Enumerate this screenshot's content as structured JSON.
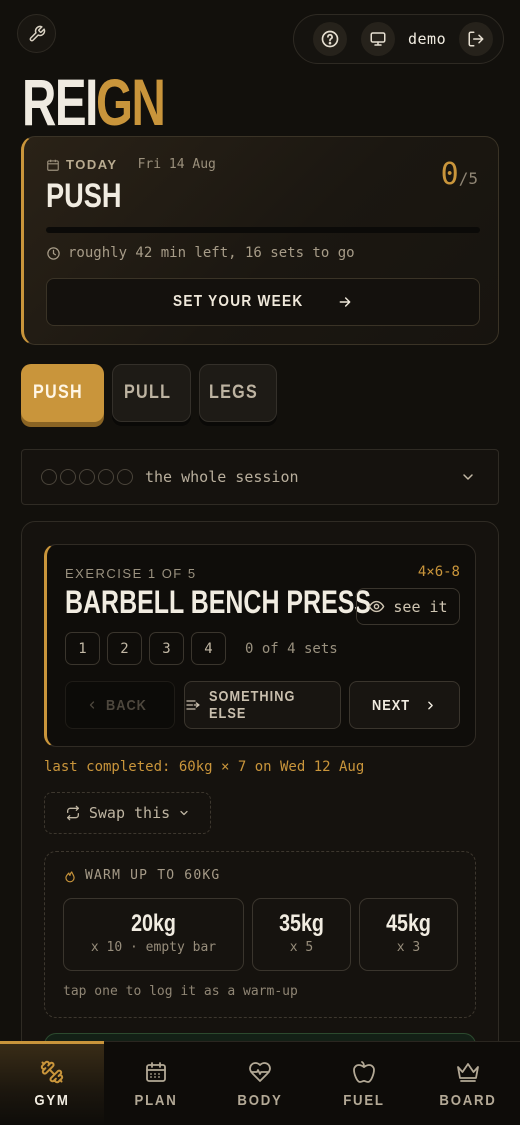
{
  "top": {
    "user": "demo",
    "icons": [
      "wrench-icon",
      "help-icon",
      "monitor-icon",
      "logout-icon"
    ]
  },
  "logo": {
    "part1": "REI",
    "part2": "GN"
  },
  "today": {
    "label": "TODAY",
    "date": "Fri 14 Aug",
    "workout": "PUSH",
    "done": "0",
    "total": "/5",
    "progress": 0,
    "time_left": "roughly 42 min left, 16 sets to go",
    "set_week": "SET YOUR WEEK"
  },
  "tabs": [
    {
      "label": "PUSH",
      "active": true
    },
    {
      "label": "PULL",
      "active": false
    },
    {
      "label": "LEGS",
      "active": false
    }
  ],
  "session": {
    "label": "the whole session",
    "exercise_count": 5
  },
  "exercise": {
    "label": "EXERCISE 1 OF 5",
    "scheme": "4×6-8",
    "name": "BARBELL BENCH PRESS",
    "see_it": "see it",
    "sets": [
      "1",
      "2",
      "3",
      "4"
    ],
    "sets_done": "0 of 4 sets",
    "back": "BACK",
    "something_else": "SOMETHING ELSE",
    "next": "NEXT"
  },
  "last_completed": "last completed: 60kg × 7 on Wed 12 Aug",
  "swap": "Swap this",
  "warmup": {
    "title": "WARM UP TO 60KG",
    "sets": [
      {
        "weight": "20kg",
        "reps": "x 10 · empty bar"
      },
      {
        "weight": "35kg",
        "reps": "x 5"
      },
      {
        "weight": "45kg",
        "reps": "x 3"
      }
    ],
    "hint": "tap one to log it as a warm-up"
  },
  "nav": [
    {
      "label": "GYM",
      "icon": "dumbbell-icon",
      "active": true
    },
    {
      "label": "PLAN",
      "icon": "calendar-icon",
      "active": false
    },
    {
      "label": "BODY",
      "icon": "heart-pulse-icon",
      "active": false
    },
    {
      "label": "FUEL",
      "icon": "apple-icon",
      "active": false
    },
    {
      "label": "BOARD",
      "icon": "crown-icon",
      "active": false
    }
  ],
  "colors": {
    "accent": "#c9953b",
    "background": "#12100c",
    "text": "#f1ece1"
  }
}
